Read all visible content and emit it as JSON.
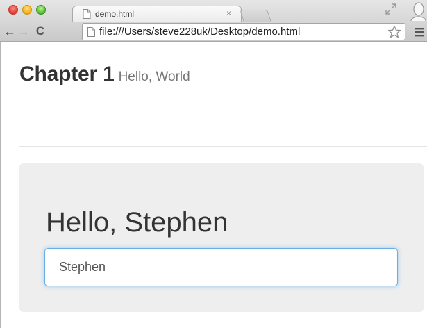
{
  "browser": {
    "tab_title": "demo.html",
    "tab_close": "×",
    "url": "file:///Users/steve228uk/Desktop/demo.html",
    "back_glyph": "←",
    "forward_glyph": "→",
    "reload_glyph": "C",
    "icons": [
      "page-icon",
      "fullscreen-icon",
      "profile-icon",
      "star-icon",
      "menu-icon"
    ]
  },
  "page": {
    "header_title": "Chapter 1",
    "header_subtitle": "Hello, World",
    "greeting": "Hello, Stephen",
    "name_input_value": "Stephen"
  },
  "colors": {
    "jumbotron_bg": "#eeeeee",
    "input_focus_border": "#66afe9",
    "heading_text": "#333333",
    "subtitle_text": "#777777"
  }
}
